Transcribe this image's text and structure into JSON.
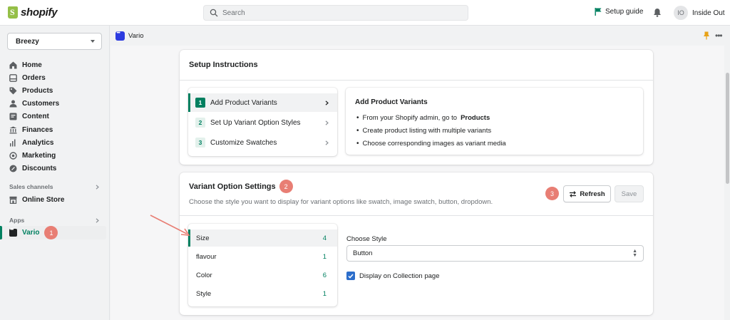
{
  "topbar": {
    "brand": "shopify",
    "search_placeholder": "Search",
    "setup_guide": "Setup guide",
    "avatar_initials": "IO",
    "user_name": "Inside Out"
  },
  "sidebar": {
    "store": "Breezy",
    "items": [
      {
        "label": "Home",
        "icon": "home-icon"
      },
      {
        "label": "Orders",
        "icon": "orders-icon"
      },
      {
        "label": "Products",
        "icon": "tag-icon"
      },
      {
        "label": "Customers",
        "icon": "person-icon"
      },
      {
        "label": "Content",
        "icon": "content-icon"
      },
      {
        "label": "Finances",
        "icon": "bank-icon"
      },
      {
        "label": "Analytics",
        "icon": "bar-chart-icon"
      },
      {
        "label": "Marketing",
        "icon": "target-icon"
      },
      {
        "label": "Discounts",
        "icon": "discount-icon"
      }
    ],
    "sales_channels_heading": "Sales channels",
    "online_store": "Online Store",
    "apps_heading": "Apps",
    "vario": "Vario",
    "vario_badge": "1"
  },
  "app_header": {
    "title": "Vario"
  },
  "setup": {
    "title": "Setup Instructions",
    "steps": [
      {
        "num": "1",
        "label": "Add Product Variants"
      },
      {
        "num": "2",
        "label": "Set Up Variant Option Styles"
      },
      {
        "num": "3",
        "label": "Customize Swatches"
      }
    ],
    "info_title": "Add Product Variants",
    "info_1_prefix": "From your Shopify admin, go to",
    "info_1_bold": "Products",
    "info_2": "Create product listing with multiple variants",
    "info_3": "Choose corresponding images as variant media"
  },
  "variant": {
    "title": "Variant Option Settings",
    "title_badge": "2",
    "subtitle": "Choose the style you want to display for variant options like swatch, image swatch, button, dropdown.",
    "refresh_badge": "3",
    "refresh_label": "Refresh",
    "save_label": "Save",
    "options": [
      {
        "name": "Size",
        "count": "4"
      },
      {
        "name": "flavour",
        "count": "1"
      },
      {
        "name": "Color",
        "count": "6"
      },
      {
        "name": "Style",
        "count": "1"
      }
    ],
    "choose_style_label": "Choose Style",
    "style_value": "Button",
    "display_collection_label": "Display on Collection page",
    "display_collection_checked": true
  },
  "colors": {
    "accent_green": "#008060",
    "badge": "#e87e74",
    "checkbox_blue": "#2c6ecb",
    "app_logo_blue": "#2c3be0"
  }
}
